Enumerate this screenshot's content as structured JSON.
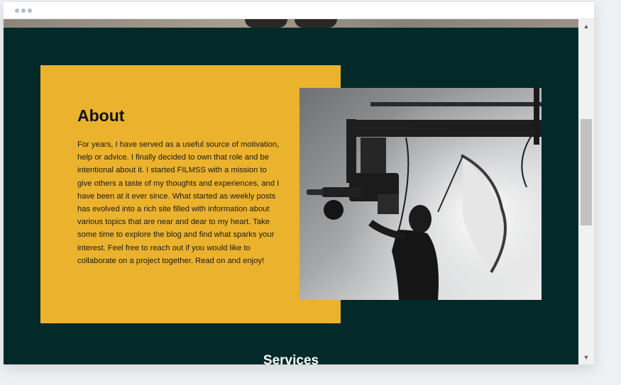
{
  "about": {
    "title": "About",
    "body": "For years, I have served as a useful source of motivation, help or advice. I finally decided to own that role and be intentional about it. I started FILMSS with a mission to give others a taste of my thoughts and experiences, and I have been at it ever since. What started as weekly posts has evolved into a rich site filled with information about various topics that are near and dear to my heart. Take some time to explore the blog and find what sparks your interest. Feel free to reach out if you would like to collaborate on a project together. Read on and enjoy!"
  },
  "services": {
    "title": "Services"
  },
  "scrollbar": {
    "up_icon": "▲",
    "down_icon": "▼",
    "position_fraction": 0.3
  },
  "colors": {
    "page_bg": "#032a29",
    "card_bg": "#ebb22d",
    "heading": "#111111"
  },
  "icons": {
    "window_dots": "window-dots-icon",
    "camera_photo": "camera-operator-photo"
  }
}
